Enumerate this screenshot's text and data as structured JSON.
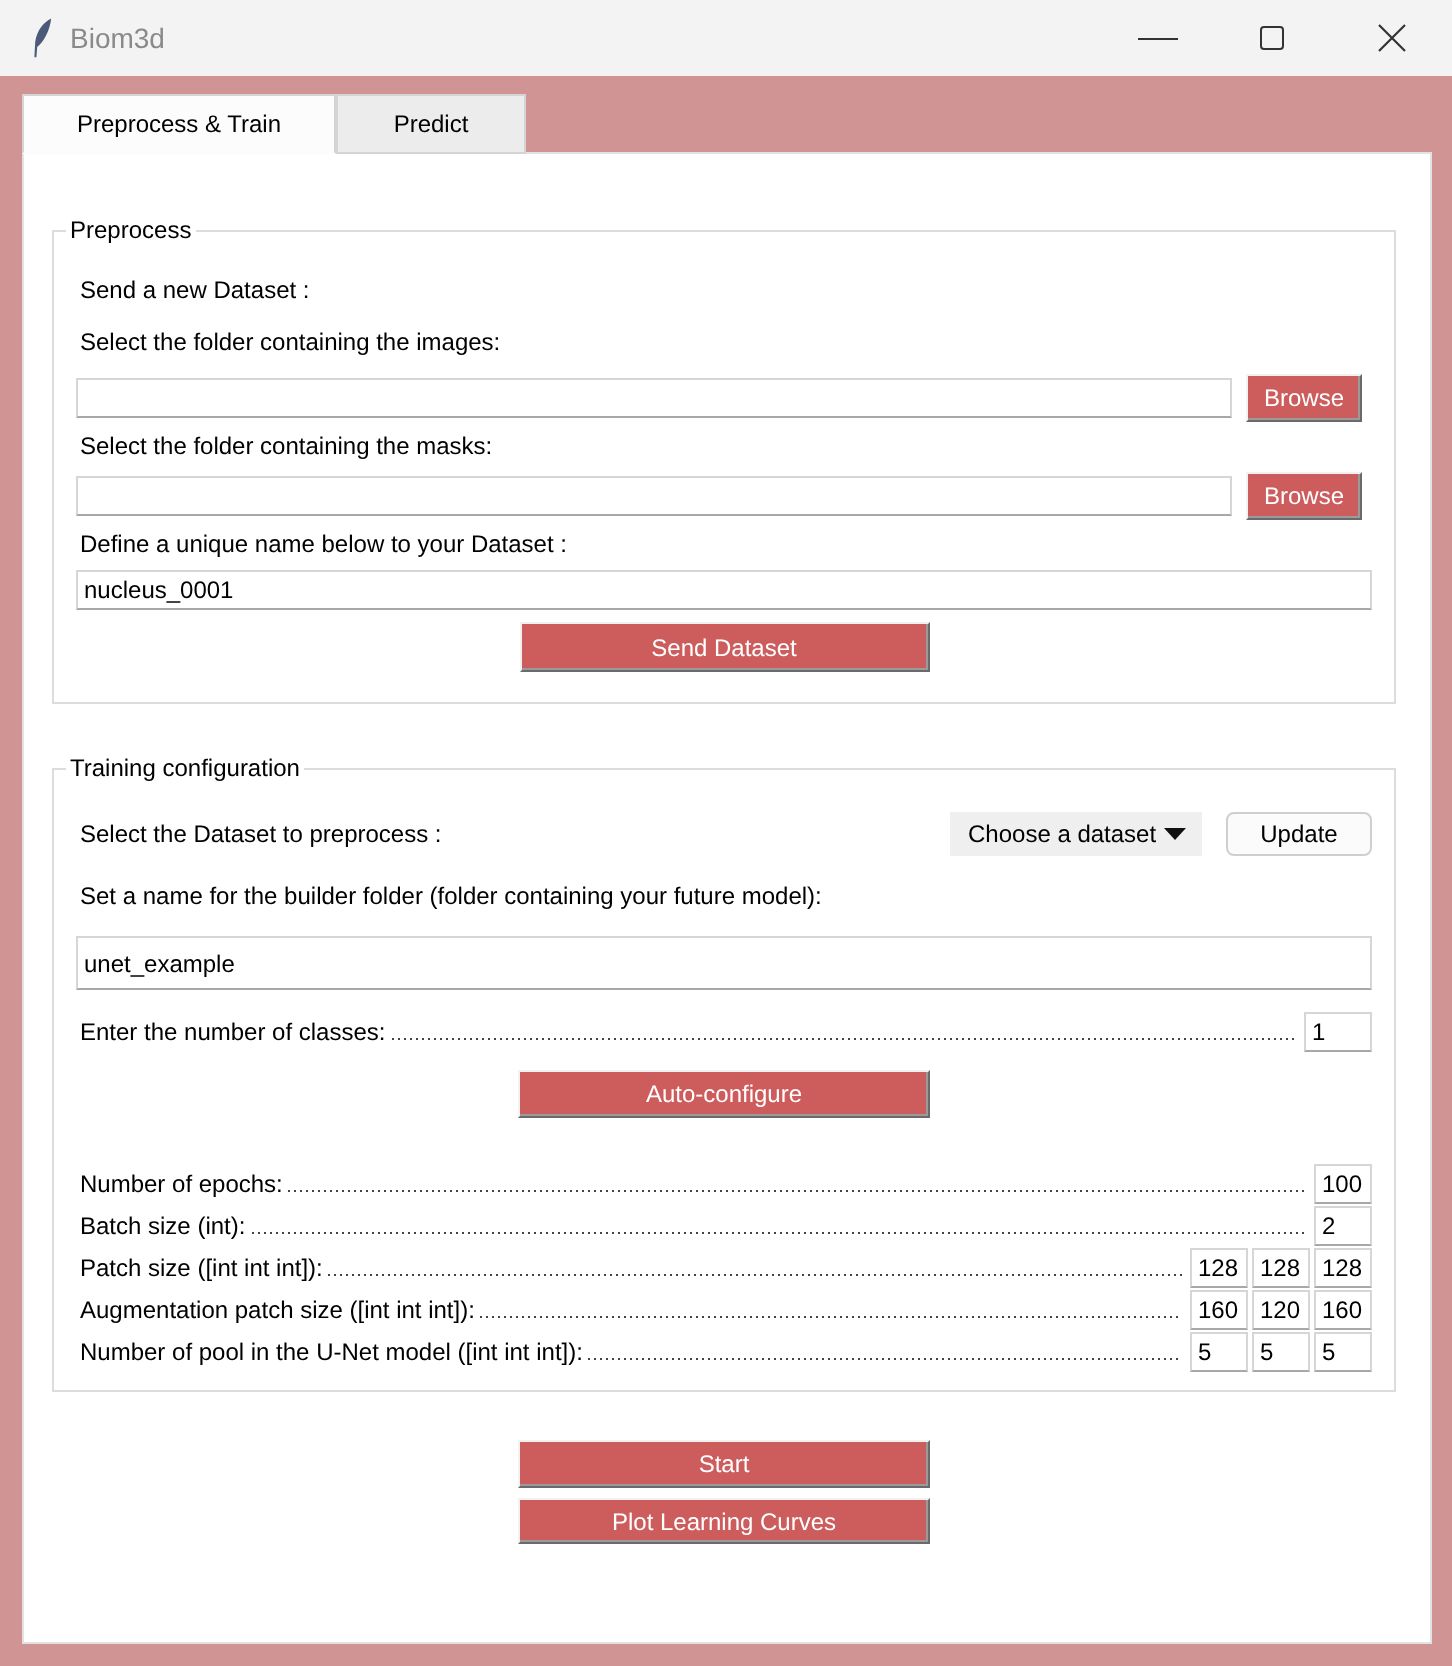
{
  "window": {
    "title": "Biom3d"
  },
  "tabs": [
    {
      "label": "Preprocess & Train",
      "selected": true
    },
    {
      "label": "Predict",
      "selected": false
    }
  ],
  "preprocess": {
    "title": "Preprocess",
    "heading": "Send a new Dataset :",
    "images_label": "Select the folder containing the images:",
    "images_browse": "Browse",
    "masks_label": "Select the folder containing the masks:",
    "masks_browse": "Browse",
    "name_label": "Define a unique name below to your Dataset :",
    "name_value": "nucleus_0001",
    "send_button": "Send Dataset"
  },
  "training": {
    "title": "Training configuration",
    "dataset_label": "Select the Dataset to preprocess :",
    "dataset_choice": "Choose a dataset",
    "update_button": "Update",
    "builder_label": "Set a name for the builder folder (folder containing your future model):",
    "builder_value": "unet_example",
    "classes": {
      "label": "Enter the number of classes:",
      "values": [
        "1"
      ]
    },
    "autoconfig_button": "Auto-configure",
    "parameters": [
      {
        "label": "Number of epochs:",
        "values": [
          "100"
        ]
      },
      {
        "label": "Batch size (int):",
        "values": [
          "2"
        ]
      },
      {
        "label": "Patch size ([int int int]):",
        "values": [
          "128",
          "128",
          "128"
        ]
      },
      {
        "label": "Augmentation patch size ([int int int]):",
        "values": [
          "160",
          "120",
          "160"
        ]
      },
      {
        "label": "Number of pool in the U-Net model ([int int int]):",
        "values": [
          "5",
          "5",
          "5"
        ]
      }
    ]
  },
  "buttons": [
    "Start",
    "Plot Learning Curves"
  ]
}
